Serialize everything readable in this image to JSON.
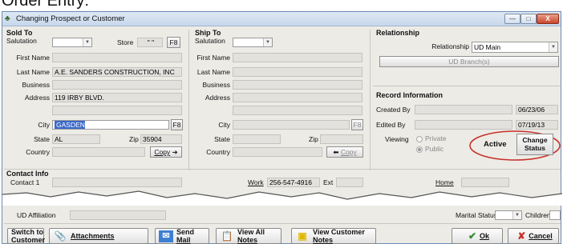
{
  "caption": "Order Entry:",
  "window": {
    "title": "Changing Prospect or Customer",
    "min_label": "—",
    "max_label": "□",
    "close_label": "X"
  },
  "sold_to": {
    "header": "Sold To",
    "salutation_label": "Salutation",
    "salutation_value": "",
    "store_label": "Store",
    "store_value": "\" \"",
    "store_button": "F8",
    "first_name_label": "First Name",
    "first_name": "",
    "last_name_label": "Last Name",
    "last_name": "A.E. SANDERS CONSTRUCTION, INC",
    "business_label": "Business",
    "business": "",
    "address_label": "Address",
    "address1": "119 IRBY BLVD.",
    "address2": "",
    "city_label": "City",
    "city": "GASDEN",
    "city_button": "F8",
    "state_label": "State",
    "state": "AL",
    "zip_label": "Zip",
    "zip": "35904",
    "country_label": "Country",
    "country": "",
    "copy_button": "Copy"
  },
  "ship_to": {
    "header": "Ship To",
    "salutation_label": "Salutation",
    "first_name_label": "First Name",
    "last_name_label": "Last Name",
    "business_label": "Business",
    "address_label": "Address",
    "city_label": "City",
    "city_button": "F8",
    "state_label": "State",
    "zip_label": "Zip",
    "country_label": "Country",
    "copy_button": "Copy"
  },
  "relationship": {
    "header": "Relationship",
    "label": "Relationship",
    "value": "UD Main",
    "branch_button": "UD Branch(s)"
  },
  "record_info": {
    "header": "Record Information",
    "created_by_label": "Created By",
    "created_by": "",
    "created_date": "06/23/06",
    "edited_by_label": "Edited By",
    "edited_by": "",
    "edited_date": "07/19/13",
    "viewing_label": "Viewing",
    "private_label": "Private",
    "public_label": "Public",
    "status": "Active",
    "change_status_line1": "Change",
    "change_status_line2": "Status"
  },
  "contact_info": {
    "header": "Contact Info",
    "contact1_label": "Contact 1",
    "contact1": "",
    "work_label": "Work",
    "work": "256-547-4916",
    "ext_label": "Ext",
    "ext": "",
    "home_label": "Home",
    "home": "",
    "ud_affiliation_label": "UD Affiliation",
    "marital_status_label": "Marital Status",
    "children_label": "Children"
  },
  "buttons": {
    "switch_line1": "Switch to",
    "switch_line2": "Customer",
    "attachments": "Attachments",
    "send_line1": "Send",
    "send_line2": "Mail",
    "view_all_line1": "View All",
    "view_all_line2": "Notes",
    "view_customer_line1": "View Customer",
    "view_customer_line2": "Notes",
    "ok": "Ok",
    "cancel": "Cancel"
  },
  "colors": {
    "accent_selection": "#3a68c8",
    "highlight_circle": "#c8302a",
    "window_bg": "#ecebe6"
  }
}
